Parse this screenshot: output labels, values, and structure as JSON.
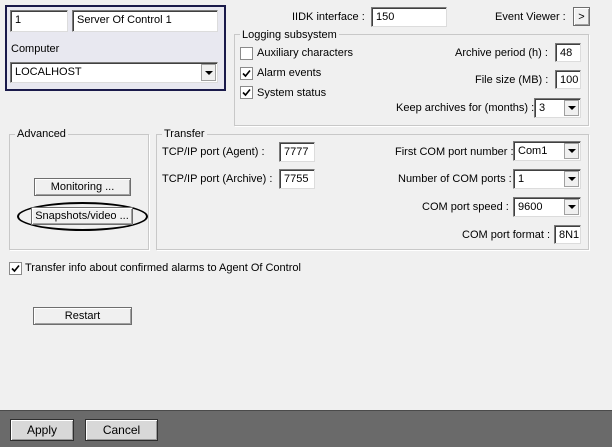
{
  "server": {
    "id": "1",
    "name": "Server Of Control 1",
    "computer_label": "Computer",
    "computer_value": "LOCALHOST"
  },
  "header": {
    "iidk_label": "IIDK interface :",
    "iidk_value": "150",
    "event_viewer_label": "Event Viewer :",
    "event_viewer_button": ">"
  },
  "logging": {
    "legend": "Logging subsystem",
    "auxiliary_label": "Auxiliary characters",
    "auxiliary_checked": false,
    "alarm_label": "Alarm events",
    "alarm_checked": true,
    "status_label": "System status",
    "status_checked": true,
    "archive_period_label": "Archive period (h) :",
    "archive_period_value": "48",
    "file_size_label": "File size (MB) :",
    "file_size_value": "100",
    "keep_archives_label": "Keep archives for (months) :",
    "keep_archives_value": "3"
  },
  "advanced": {
    "legend": "Advanced",
    "monitoring_button": "Monitoring ...",
    "snapshots_button": "Snapshots/video ...",
    "highlight_color": "#000000"
  },
  "transfer": {
    "legend": "Transfer",
    "tcp_agent_label": "TCP/IP port (Agent) :",
    "tcp_agent_value": "7777",
    "tcp_archive_label": "TCP/IP port (Archive) :",
    "tcp_archive_value": "7755",
    "first_com_label": "First COM port number :",
    "first_com_value": "Com1",
    "num_com_label": "Number of COM ports :",
    "num_com_value": "1",
    "com_speed_label": "COM port speed :",
    "com_speed_value": "9600",
    "com_format_label": "COM port format :",
    "com_format_value": "8N1"
  },
  "transfer_info": {
    "label": "Transfer info about confirmed alarms to Agent Of Control",
    "checked": true
  },
  "restart_button": "Restart",
  "footer": {
    "apply_button": "Apply",
    "cancel_button": "Cancel",
    "bar_color": "#6a6a6a"
  }
}
